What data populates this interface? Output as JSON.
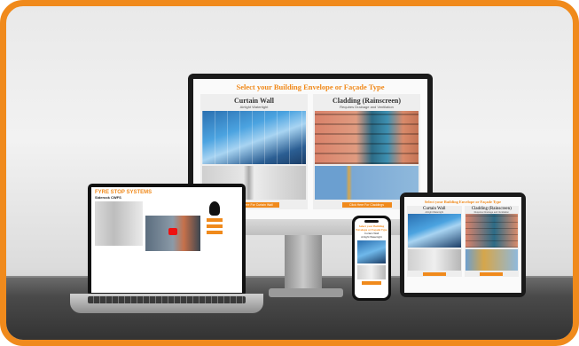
{
  "colors": {
    "accent": "#f08a1c",
    "frame": "#f08a1c"
  },
  "monitor": {
    "heading": "Select your Building Envelope or Façade Type",
    "columns": [
      {
        "title": "Curtain Wall",
        "subtitle": "Airtight Watertight",
        "button": "Click Here For Curtain Wall"
      },
      {
        "title": "Cladding (Rainscreen)",
        "subtitle": "Requires Drainage and Ventilation",
        "button": "Click Here For Claddings"
      }
    ]
  },
  "laptop": {
    "brand": "FYRE STOP SYSTEMS",
    "title": "Siderock CWFS"
  },
  "phone": {
    "heading": "Select your Building Envelope or Façade Type",
    "column_title": "Curtain Wall",
    "column_subtitle": "Airtight Watertight"
  },
  "tablet": {
    "heading": "Select your Building Envelope or Façade Type",
    "columns": [
      {
        "title": "Curtain Wall",
        "subtitle": "Airtight Watertight"
      },
      {
        "title": "Cladding (Rainscreen)",
        "subtitle": "Requires Drainage and Ventilation"
      }
    ]
  }
}
